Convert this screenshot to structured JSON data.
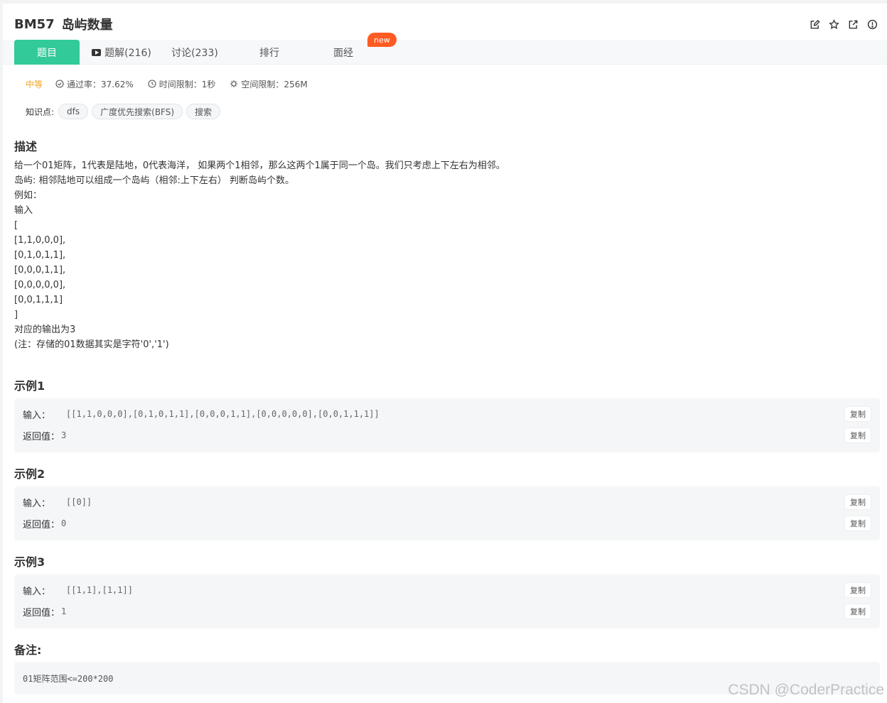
{
  "problem": {
    "code": "BM57",
    "title": "岛屿数量"
  },
  "tabs": [
    {
      "label": "题目"
    },
    {
      "label": "题解(216)"
    },
    {
      "label": "讨论(233)"
    },
    {
      "label": "排行"
    },
    {
      "label": "面经"
    }
  ],
  "new_badge": "new",
  "meta": {
    "difficulty": "中等",
    "pass_rate": "通过率：37.62%",
    "time_limit": "时间限制：1秒",
    "space_limit": "空间限制：256M"
  },
  "tags": {
    "label": "知识点:",
    "items": [
      "dfs",
      "广度优先搜索(BFS)",
      "搜索"
    ]
  },
  "description": {
    "heading": "描述",
    "lines": [
      "给一个01矩阵，1代表是陆地，0代表海洋， 如果两个1相邻，那么这两个1属于同一个岛。我们只考虑上下左右为相邻。",
      "岛屿: 相邻陆地可以组成一个岛屿（相邻:上下左右） 判断岛屿个数。",
      "例如：",
      "输入",
      "[",
      "[1,1,0,0,0],",
      "[0,1,0,1,1],",
      "[0,0,0,1,1],",
      "[0,0,0,0,0],",
      "[0,0,1,1,1]",
      "]",
      "对应的输出为3",
      "(注：存储的01数据其实是字符'0','1')"
    ]
  },
  "examples": [
    {
      "heading": "示例1",
      "input_label": "输入：",
      "input": "[[1,1,0,0,0],[0,1,0,1,1],[0,0,0,1,1],[0,0,0,0,0],[0,0,1,1,1]]",
      "output_label": "返回值：",
      "output": "3",
      "copy": "复制"
    },
    {
      "heading": "示例2",
      "input_label": "输入：",
      "input": "[[0]]",
      "output_label": "返回值：",
      "output": "0",
      "copy": "复制"
    },
    {
      "heading": "示例3",
      "input_label": "输入：",
      "input": "[[1,1],[1,1]]",
      "output_label": "返回值：",
      "output": "1",
      "copy": "复制"
    }
  ],
  "remark": {
    "heading": "备注:",
    "text": "01矩阵范围<=200*200"
  },
  "watermark": "CSDN @CoderPractice",
  "colors": {
    "accent": "#32ca99",
    "badge": "#ff5b22",
    "difficulty": "#f6a623"
  }
}
